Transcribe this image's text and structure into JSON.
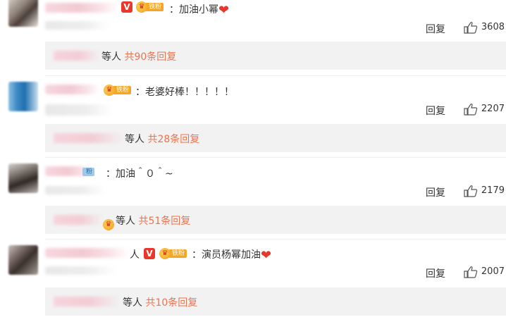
{
  "comments": [
    {
      "text": "：加油小幂",
      "reply_label": "回复",
      "likes": "3608",
      "fan_tag": "铁粉",
      "has_v": true,
      "has_heart": true,
      "thread": {
        "who_suffix": "等人",
        "count_text": "共90条回复"
      }
    },
    {
      "text": "：老婆好棒！！！！！",
      "reply_label": "回复",
      "likes": "2207",
      "fan_tag": "铁粉",
      "has_v": false,
      "has_heart": false,
      "thread": {
        "who_suffix": "等人",
        "count_text": "共28条回复"
      }
    },
    {
      "text": "：加油＾０＾~",
      "reply_label": "回复",
      "likes": "2179",
      "fan_tag": "粉",
      "has_v": false,
      "has_heart": false,
      "thread": {
        "who_suffix": "等人",
        "count_text": "共51条回复"
      }
    },
    {
      "text": "：演员杨幂加油",
      "reply_label": "回复",
      "likes": "2007",
      "fan_tag": "铁粉",
      "has_v": true,
      "has_heart": true,
      "name_tail": "人",
      "thread": {
        "who_suffix": "等人",
        "count_text": "共10条回复"
      }
    }
  ],
  "icons": {
    "like": "thumbs-up-icon",
    "heart": "heart-icon",
    "verified": "verified-v-icon",
    "fan_badge": "fan-crown-icon"
  },
  "colors": {
    "accent_orange": "#eb7350",
    "verified_red": "#e8372b",
    "fan_gold": "#f5a623",
    "thread_bg": "#f2f2f2"
  },
  "symbols": {
    "heart": "❤",
    "v": "V",
    "crown": "♛"
  }
}
